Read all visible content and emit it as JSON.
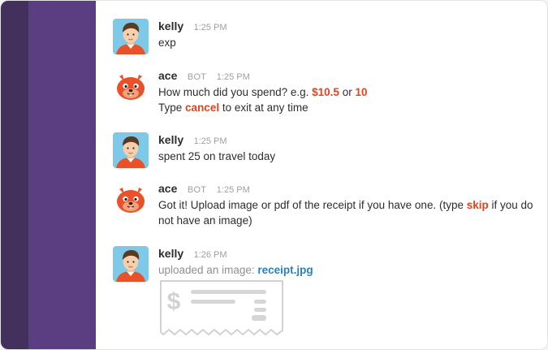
{
  "colors": {
    "sidebar_dark": "#44305d",
    "sidebar": "#5b3e82",
    "highlight": "#e0441e",
    "link": "#2a80b9"
  },
  "messages": [
    {
      "author": "kelly",
      "time": "1:25 PM",
      "avatar": "kelly-avatar",
      "text": "exp"
    },
    {
      "author": "ace",
      "bot_tag": "BOT",
      "time": "1:25 PM",
      "avatar": "ace-bot-avatar",
      "line1_prefix": "How much did you spend? e.g.",
      "example_1": "$10.5",
      "or_word": "or",
      "example_2": "10",
      "line2_prefix": "Type",
      "cancel_word": "cancel",
      "line2_suffix": "to exit at any time"
    },
    {
      "author": "kelly",
      "time": "1:25 PM",
      "avatar": "kelly-avatar",
      "text": "spent 25 on travel today"
    },
    {
      "author": "ace",
      "bot_tag": "BOT",
      "time": "1:25 PM",
      "avatar": "ace-bot-avatar",
      "text_prefix": "Got it! Upload image or pdf of the receipt if you have one. (type",
      "skip_word": "skip",
      "text_suffix": "if you do not have an image)"
    },
    {
      "author": "kelly",
      "time": "1:26 PM",
      "avatar": "kelly-avatar",
      "upload_text": "uploaded an image:",
      "file_name": "receipt.jpg",
      "preview_icon": "receipt-icon"
    }
  ]
}
